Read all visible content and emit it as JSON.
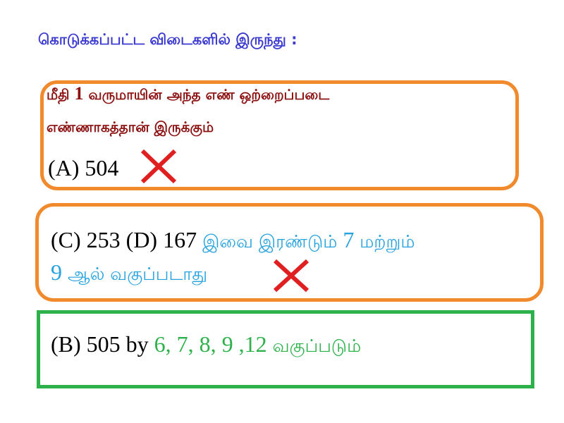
{
  "heading": "கொடுக்கப்பட்ட விடைகளில் இருந்து :",
  "box1": {
    "line1_a": "மீதி ",
    "line1_num": "1",
    "line1_b": " வருமாயின் அந்த எண் ஒற்றைப்படை",
    "line2": "எண்ணாகத்தான்  இருக்கும்",
    "option": "(A) 504"
  },
  "box2": {
    "options": "(C) 253 (D) 167 ",
    "text1": "இவை இரண்டும் ",
    "num7": "7",
    "text2": " மற்றும்",
    "num9": "9",
    "text3": " ஆல் வகுப்படாது"
  },
  "box3": {
    "option": "(B) 505 by ",
    "divisors": "6, 7, 8, 9 ,12",
    "text": " வகுப்படும்"
  },
  "colors": {
    "heading": "#3a3ad0",
    "dark_red": "#8b1010",
    "orange_border": "#f08a2c",
    "green": "#2db14a",
    "blue": "#26a2e0",
    "cross_red": "#e02020"
  },
  "icons": [
    "cross-mark-icon",
    "cross-mark-icon"
  ]
}
